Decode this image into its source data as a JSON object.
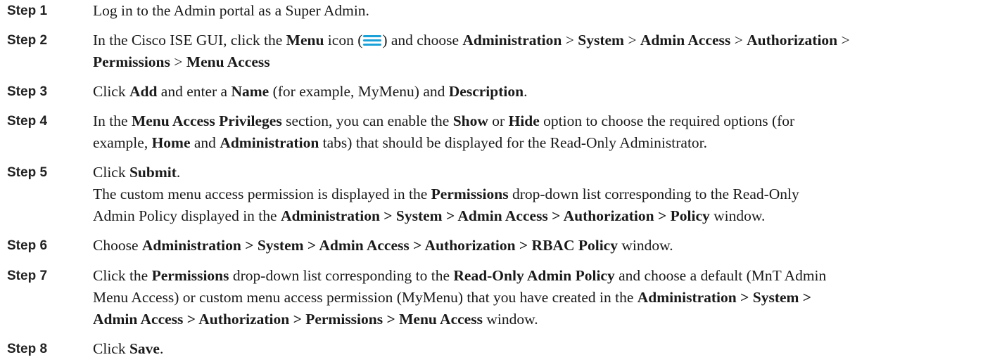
{
  "colors": {
    "menu_icon": "#1aa2d8",
    "text": "#1a1a1a",
    "label": "#222222"
  },
  "icons": {
    "menu": "hamburger-menu-icon"
  },
  "steps": [
    {
      "label": "Step 1",
      "t": [
        "Log in to the Admin portal as a Super Admin."
      ]
    },
    {
      "label": "Step 2",
      "t": [
        "In the Cisco ISE GUI, click the ",
        "Menu",
        " icon (",
        ") and choose ",
        "Administration",
        " > ",
        "System",
        " > ",
        "Admin Access",
        " > ",
        "Authorization",
        " >",
        "Permissions",
        " > ",
        "Menu Access"
      ]
    },
    {
      "label": "Step 3",
      "t": [
        "Click ",
        "Add",
        " and enter a ",
        "Name",
        " (for example, MyMenu) and ",
        "Description",
        "."
      ]
    },
    {
      "label": "Step 4",
      "t": [
        "In the ",
        "Menu Access Privileges",
        " section, you can enable the ",
        "Show",
        " or ",
        "Hide",
        " option to choose the required options (for",
        "example, ",
        "Home",
        " and ",
        "Administration",
        " tabs) that should be displayed for the Read-Only Administrator."
      ]
    },
    {
      "label": "Step 5",
      "t": [
        "Click ",
        "Submit",
        ".",
        "The custom menu access permission is displayed in the ",
        "Permissions",
        " drop-down list corresponding to the Read-Only",
        "Admin Policy displayed in the ",
        "Administration > System > Admin Access > Authorization > Policy",
        " window."
      ]
    },
    {
      "label": "Step 6",
      "t": [
        "Choose ",
        "Administration > System > Admin Access > Authorization > RBAC Policy",
        " window."
      ]
    },
    {
      "label": "Step 7",
      "t": [
        "Click the ",
        "Permissions",
        " drop-down list corresponding to the ",
        "Read-Only Admin Policy",
        " and choose a default (MnT Admin",
        "Menu Access) or custom menu access permission (MyMenu) that you have created in the ",
        "Administration > System >",
        "Admin Access > Authorization > Permissions > Menu Access",
        " window."
      ]
    },
    {
      "label": "Step 8",
      "t": [
        "Click ",
        "Save",
        "."
      ]
    }
  ]
}
